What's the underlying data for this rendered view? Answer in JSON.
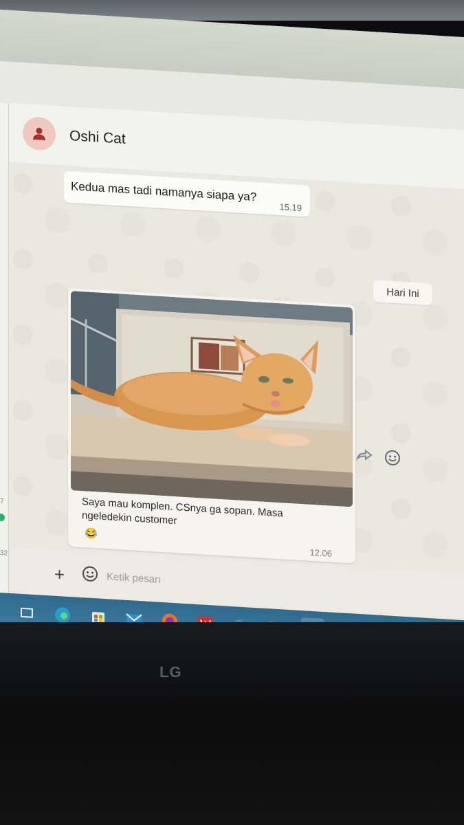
{
  "contact": {
    "name": "Oshi Cat"
  },
  "messages": [
    {
      "text": "Kedua mas tadi namanya siapa ya?",
      "time": "15.19"
    }
  ],
  "day_separator": "Hari Ini",
  "image_message": {
    "caption": "Saya mau komplen. CSnya ga sopan. Masa ngeledekin customer",
    "time": "12.06"
  },
  "composer": {
    "placeholder": "Ketik pesan"
  },
  "left_panel": {
    "mark_top": "7",
    "mark_bottom": "32"
  },
  "monitor": {
    "brand": "LG"
  },
  "colors": {
    "online_dot": "#25b36a",
    "taskbar": "#3a7799",
    "avatar_bg": "#f0c9be",
    "avatar_icon": "#a0312a"
  },
  "icons": [
    "user-icon",
    "forward-icon",
    "emoji-icon",
    "plus-icon",
    "sticker-icon",
    "task-view-icon",
    "edge-icon",
    "store-icon",
    "mail-icon",
    "firefox-icon",
    "wps-icon",
    "app-icon",
    "folder-icon",
    "chrome-icon",
    "app-icon-2"
  ]
}
